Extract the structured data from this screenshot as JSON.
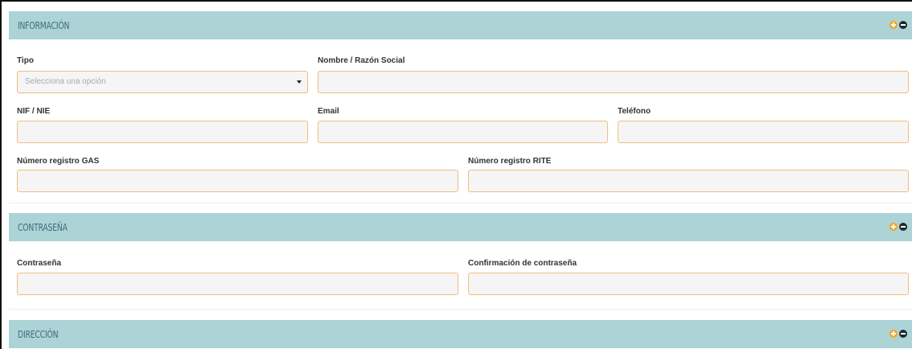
{
  "sections": {
    "informacion": {
      "title": "INFORMACIÓN",
      "tipo": {
        "label": "Tipo",
        "placeholder": "Selecciona una opción"
      },
      "nombre": {
        "label": "Nombre / Razón Social",
        "value": ""
      },
      "nif": {
        "label": "NIF / NIE",
        "value": ""
      },
      "email": {
        "label": "Email",
        "value": ""
      },
      "telefono": {
        "label": "Teléfono",
        "value": ""
      },
      "registro_gas": {
        "label": "Número registro GAS",
        "value": ""
      },
      "registro_rite": {
        "label": "Número registro RITE",
        "value": ""
      }
    },
    "contrasena": {
      "title": "CONTRASEÑA",
      "password": {
        "label": "Contraseña",
        "value": ""
      },
      "password_confirm": {
        "label": "Confirmación de contraseña",
        "value": ""
      }
    },
    "direccion": {
      "title": "DIRECCIÓN"
    }
  },
  "icons": {
    "expand": "plus-circle-icon",
    "collapse": "minus-circle-icon"
  },
  "colors": {
    "header_bg": "#acd3d6",
    "header_text": "#3e6b78",
    "field_border": "#f0bd7c",
    "field_bg": "#f5f5f5",
    "expand_icon": "#f5a623",
    "collapse_icon": "#1e2a2f"
  }
}
